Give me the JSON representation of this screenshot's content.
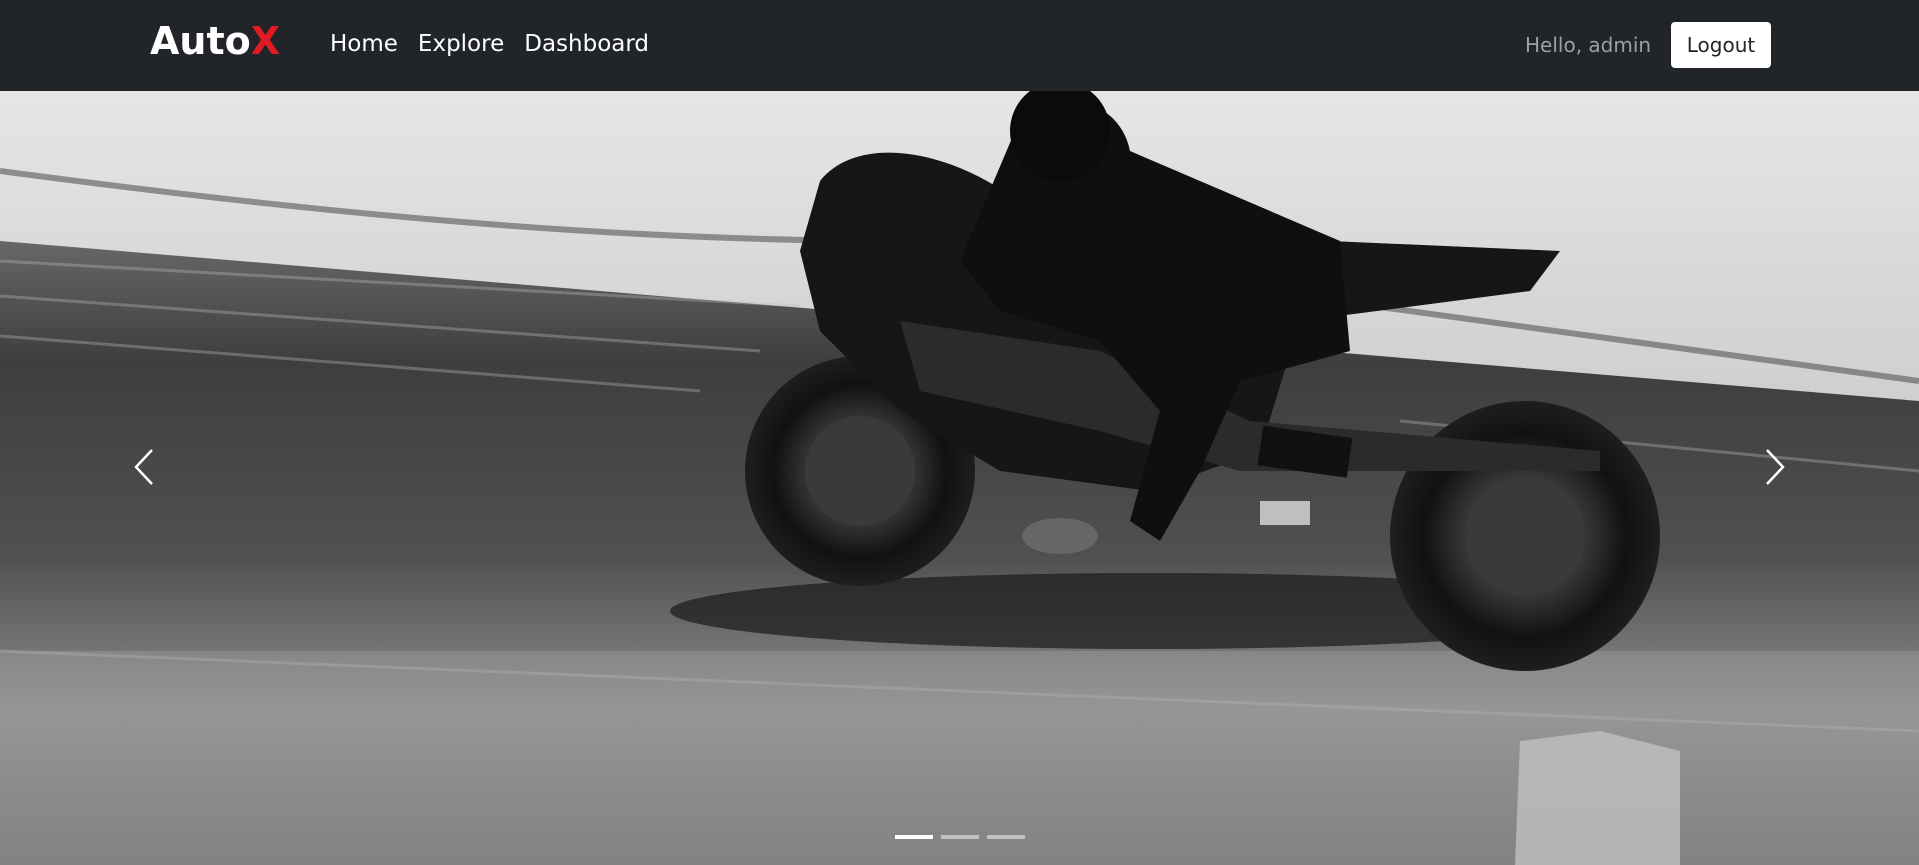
{
  "brand": {
    "text": "Auto",
    "accent_text": "X",
    "accent_color": "#e21a22"
  },
  "nav": {
    "links": [
      {
        "label": "Home"
      },
      {
        "label": "Explore"
      },
      {
        "label": "Dashboard"
      }
    ],
    "greeting": "Hello, admin",
    "logout_label": "Logout"
  },
  "carousel": {
    "slide_count": 3,
    "active_index": 0,
    "prev_icon": "chevron-left-icon",
    "next_icon": "chevron-right-icon",
    "slide_image": "black-and-white photo of a motorcycle racer on a drag strip"
  },
  "colors": {
    "navbar_bg": "#212529",
    "text": "#ffffff",
    "muted": "#9aa0a6"
  }
}
